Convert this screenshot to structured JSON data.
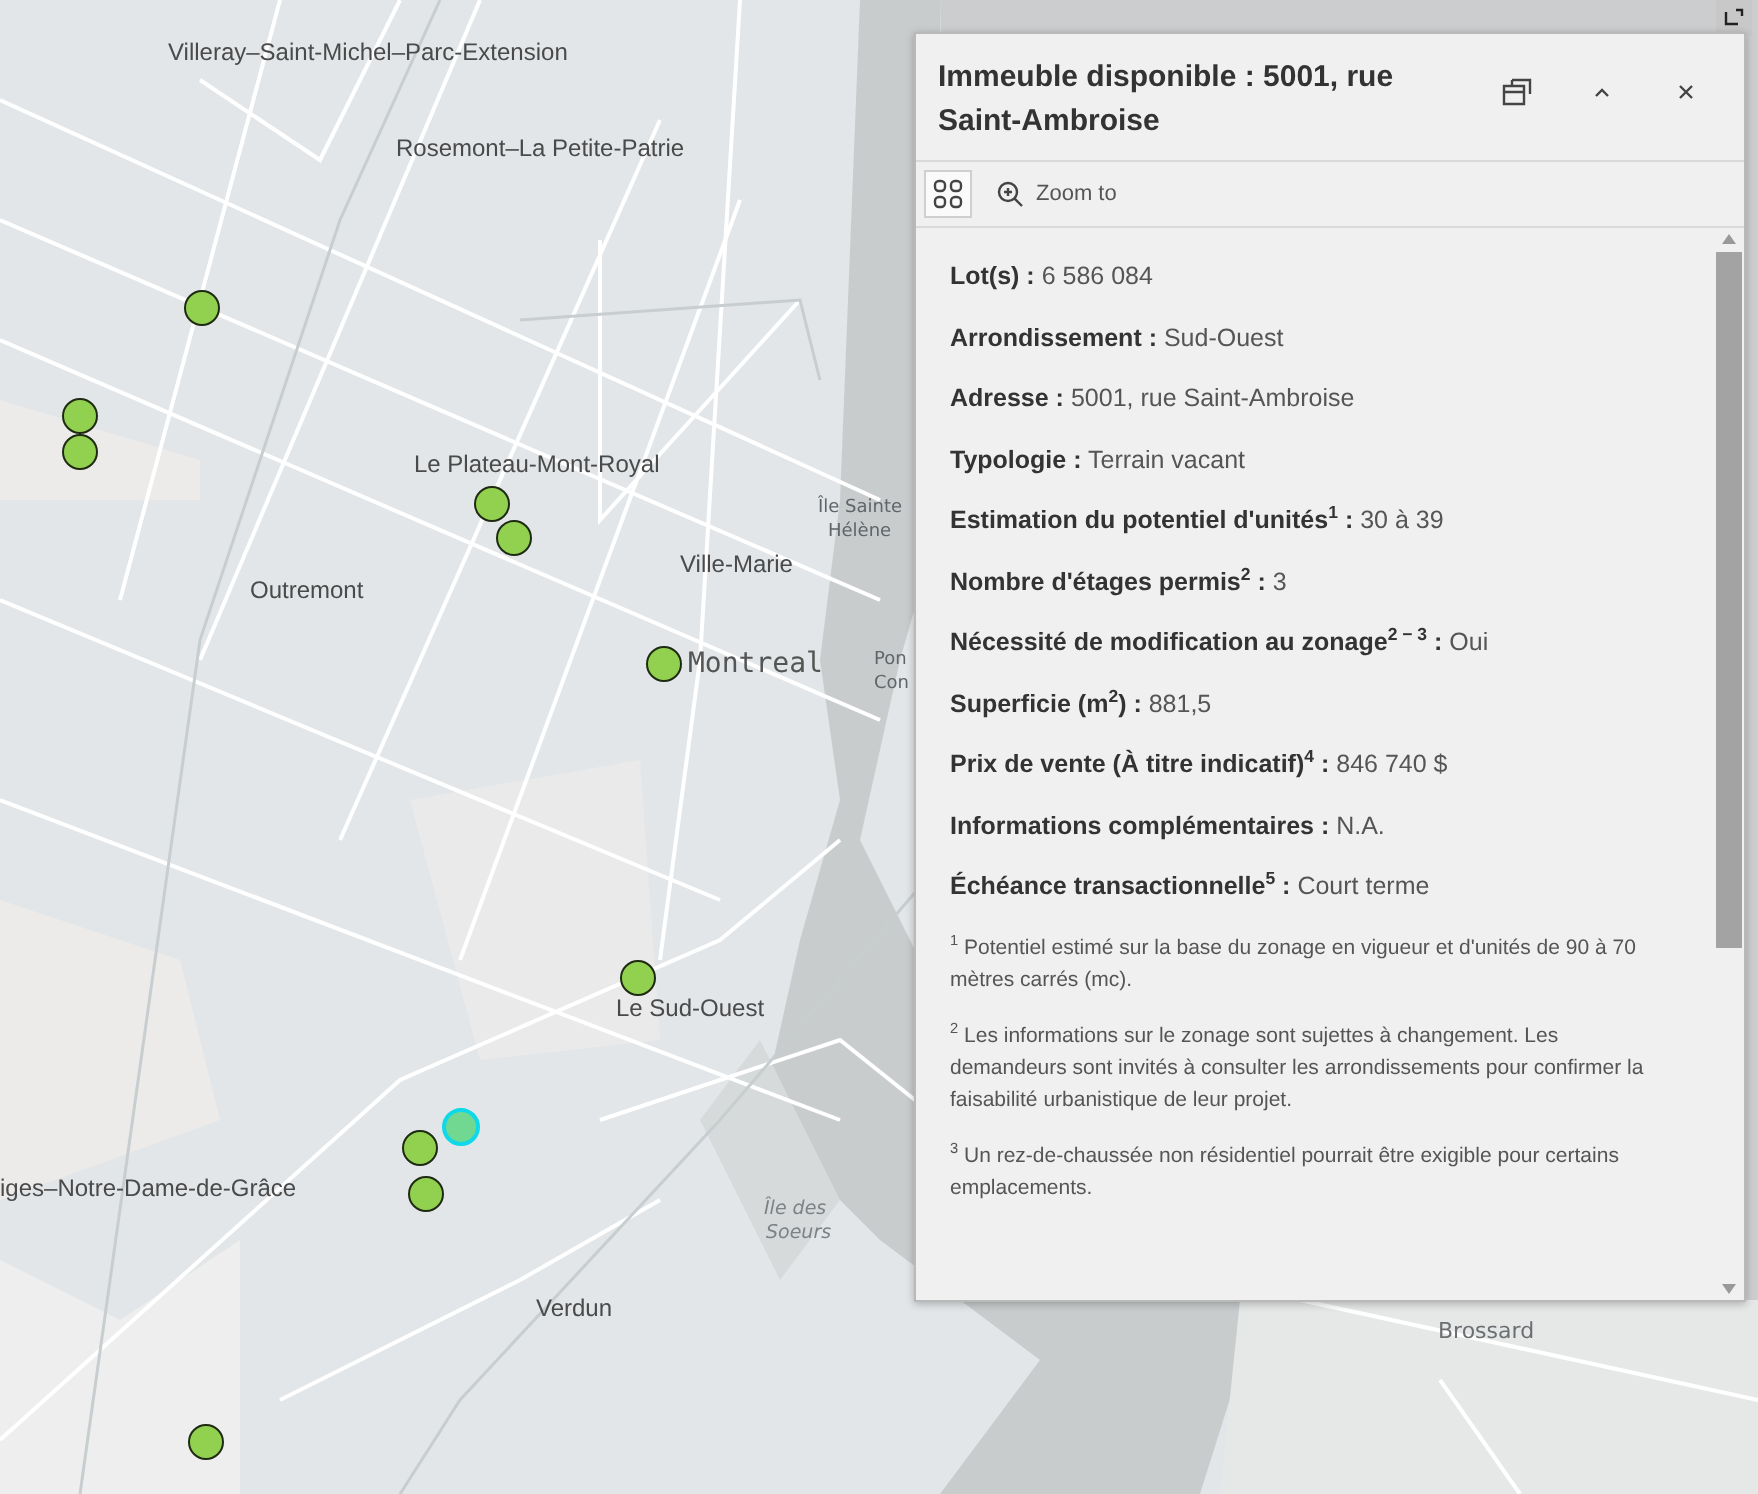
{
  "map": {
    "labels": [
      {
        "text": "Villeray–Saint-Michel–Parc-Extension",
        "kind": "district"
      },
      {
        "text": "Rosemont–La Petite-Patrie",
        "kind": "district"
      },
      {
        "text": "Le Plateau-Mont-Royal",
        "kind": "district"
      },
      {
        "text": "Île Sainte",
        "kind": "water"
      },
      {
        "text": "Hélène",
        "kind": "water"
      },
      {
        "text": "Ville-Marie",
        "kind": "district"
      },
      {
        "text": "Outremont",
        "kind": "district"
      },
      {
        "text": "Montreal",
        "kind": "city"
      },
      {
        "text": "Pon",
        "kind": "water"
      },
      {
        "text": "Con",
        "kind": "water"
      },
      {
        "text": "Le Sud-Ouest",
        "kind": "district"
      },
      {
        "text": "iges–Notre-Dame-de-Grâce",
        "kind": "district"
      },
      {
        "text": "Île des",
        "kind": "island"
      },
      {
        "text": "Soeurs",
        "kind": "island"
      },
      {
        "text": "Verdun",
        "kind": "district"
      },
      {
        "text": "Brossard",
        "kind": "town"
      }
    ],
    "markers": [
      {
        "selected": false
      },
      {
        "selected": false
      },
      {
        "selected": false
      },
      {
        "selected": false
      },
      {
        "selected": false
      },
      {
        "selected": false
      },
      {
        "selected": false
      },
      {
        "selected": true
      },
      {
        "selected": false
      },
      {
        "selected": false
      },
      {
        "selected": false
      }
    ]
  },
  "popup": {
    "title": "Immeuble disponible : 5001, rue Saint-Ambroise",
    "toolbar": {
      "zoom_label": "Zoom to"
    },
    "fields": [
      {
        "label": "Lot(s) :",
        "value": "6 586 084"
      },
      {
        "label": "Arrondissement :",
        "value": "Sud-Ouest"
      },
      {
        "label": "Adresse :",
        "value": "5001, rue Saint-Ambroise"
      },
      {
        "label": "Typologie :",
        "value": "Terrain vacant"
      },
      {
        "label": "Estimation du potentiel d'unités$^{1}$ :",
        "value": "30 à 39"
      },
      {
        "label": "Nombre d'étages permis$^{2}$ :",
        "value": "3"
      },
      {
        "label": "Nécessité de modification au zonage$^{2 − 3}$ :",
        "value": "Oui"
      },
      {
        "label": "Superficie (m$^{2}$) :",
        "value": "881,5"
      },
      {
        "label": "Prix de vente (À titre indicatif)$^{4}$ :",
        "value": "846 740 $"
      },
      {
        "label": "Informations complémentaires :",
        "value": "N.A."
      },
      {
        "label": "Échéance transactionnelle$^{5}$ :",
        "value": "Court terme"
      }
    ],
    "footnotes": [
      "$^{1}$ Potentiel estimé sur la base du zonage en vigueur et d'unités de 90 à 70 mètres carrés (mc).",
      "$^{2}$ Les informations sur le zonage sont sujettes à changement. Les demandeurs sont invités à consulter les arrondissements pour confirmer la faisabilité urbanistique de leur projet.",
      "$^{3}$ Un rez-de-chaussée non résidentiel pourrait être exigible pour certains emplacements."
    ]
  }
}
